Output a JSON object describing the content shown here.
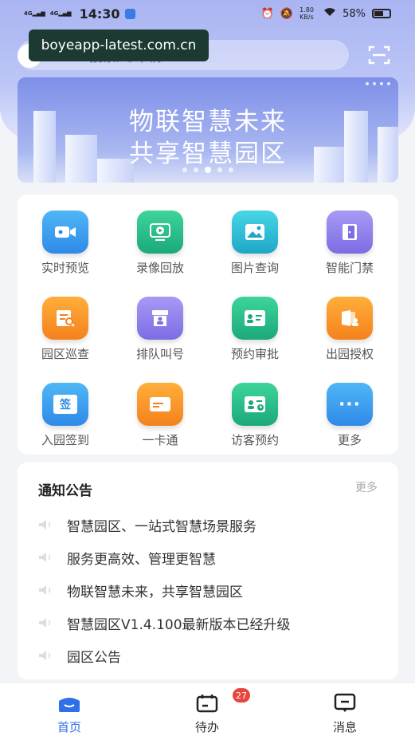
{
  "status_bar": {
    "signal1": "4G",
    "signal2": "4G",
    "time": "14:30",
    "speed": "1.80 KB/s",
    "battery": "58%"
  },
  "watermark": "boyeapp-latest.com.cn",
  "search": {
    "placeholder": "搜索人/车辆"
  },
  "banner": {
    "line1": "物联智慧未来",
    "line2": "共享智慧园区"
  },
  "grid": [
    {
      "label": "实时预览",
      "icon": "video-icon",
      "color": "blue"
    },
    {
      "label": "录像回放",
      "icon": "playback-icon",
      "color": "green"
    },
    {
      "label": "图片查询",
      "icon": "image-icon",
      "color": "cyan"
    },
    {
      "label": "智能门禁",
      "icon": "door-icon",
      "color": "purple"
    },
    {
      "label": "园区巡查",
      "icon": "patrol-icon",
      "color": "orange"
    },
    {
      "label": "排队叫号",
      "icon": "queue-icon",
      "color": "purple"
    },
    {
      "label": "预约审批",
      "icon": "approve-icon",
      "color": "green"
    },
    {
      "label": "出园授权",
      "icon": "authorize-icon",
      "color": "orange"
    },
    {
      "label": "入园签到",
      "icon": "signin-icon",
      "color": "blue"
    },
    {
      "label": "一卡通",
      "icon": "card-icon",
      "color": "orange"
    },
    {
      "label": "访客预约",
      "icon": "visitor-icon",
      "color": "green"
    },
    {
      "label": "更多",
      "icon": "more-icon",
      "color": "blue"
    }
  ],
  "grid_icon_text": {
    "signin": "签",
    "more": "···"
  },
  "notice": {
    "title": "通知公告",
    "more": "更多",
    "items": [
      "智慧园区、一站式智慧场景服务",
      "服务更高效、管理更智慧",
      "物联智慧未来，共享智慧园区",
      "智慧园区V1.4.100最新版本已经升级",
      "园区公告"
    ]
  },
  "tabs": [
    {
      "label": "首页",
      "icon": "home-icon",
      "active": true
    },
    {
      "label": "待办",
      "icon": "todo-icon",
      "badge": "27"
    },
    {
      "label": "消息",
      "icon": "message-icon"
    }
  ]
}
